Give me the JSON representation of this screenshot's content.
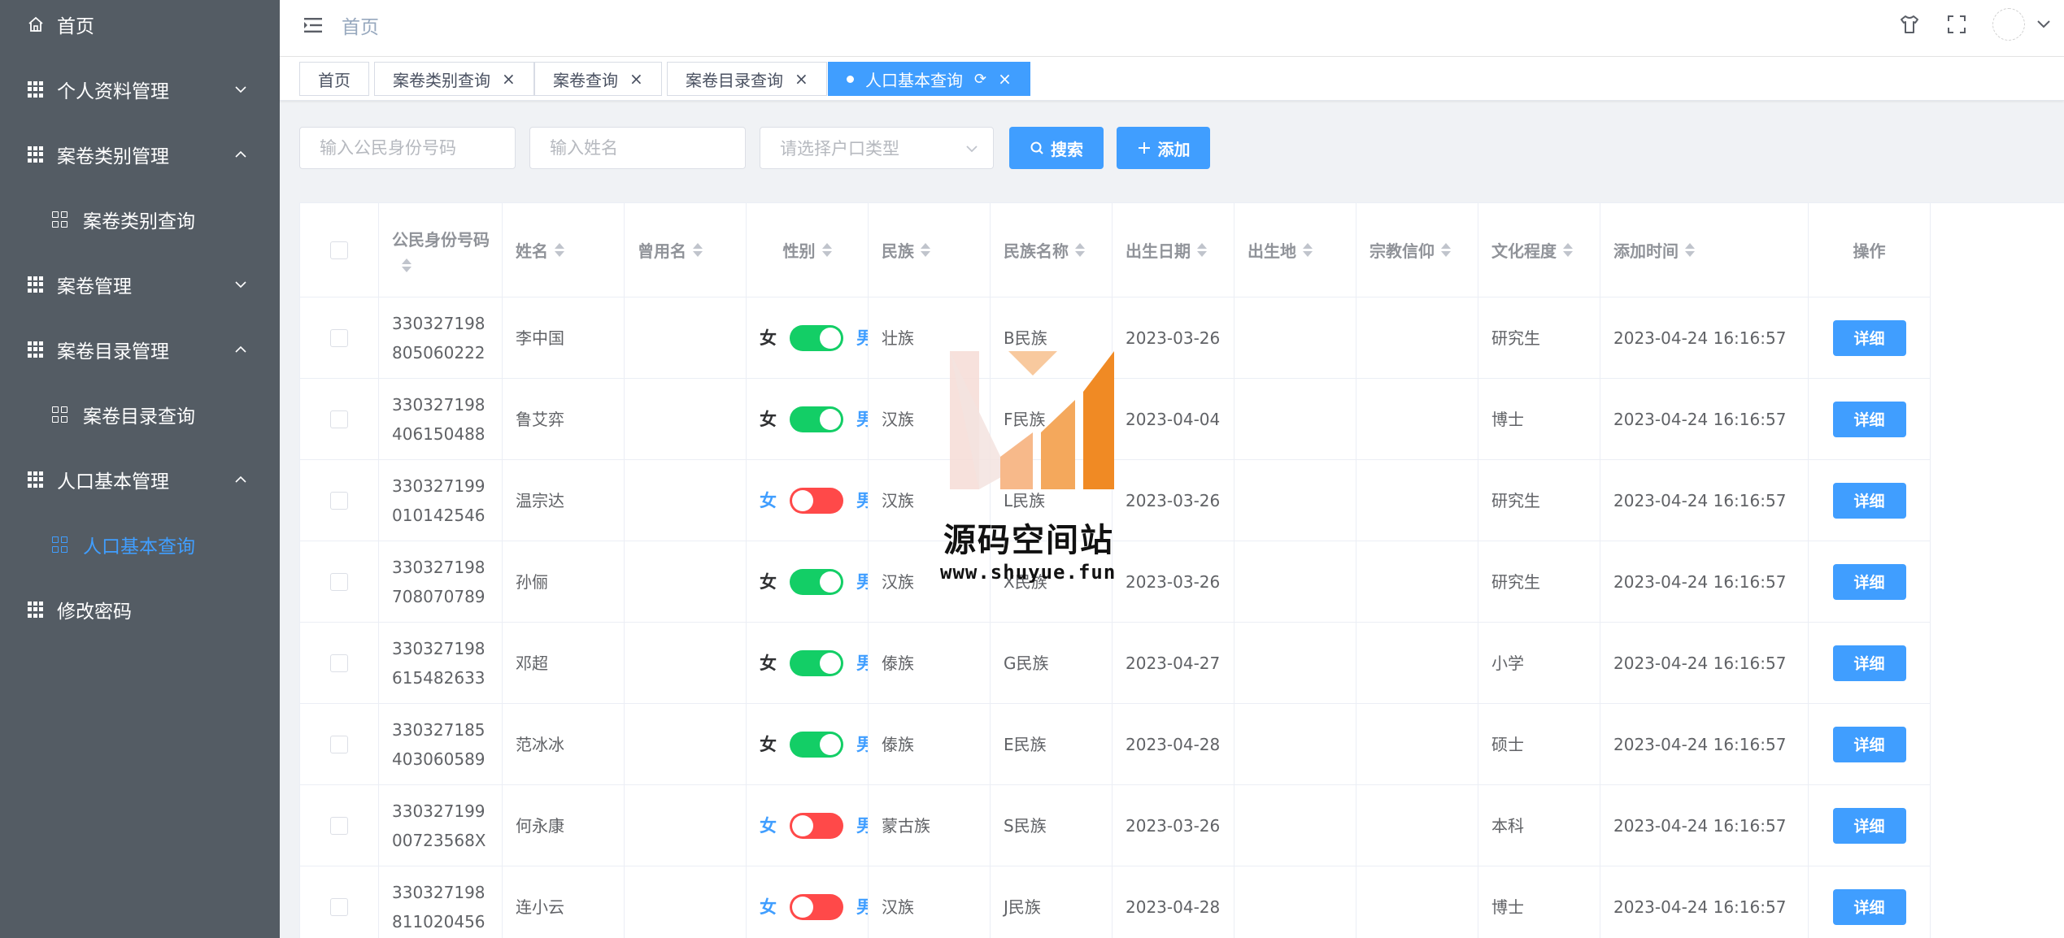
{
  "colors": {
    "primary": "#409eff",
    "sidebar_bg": "#545c64",
    "switch_on": "#13ce66",
    "switch_off": "#ff4949",
    "watermark_orange": "#f08a24"
  },
  "sidebar": {
    "items": [
      {
        "label": "首页",
        "icon": "home-icon"
      },
      {
        "label": "个人资料管理",
        "icon": "grid-icon",
        "chevron": "down"
      },
      {
        "label": "案卷类别管理",
        "icon": "grid-icon",
        "chevron": "up"
      },
      {
        "label": "案卷类别查询",
        "icon": "submenu-icon",
        "sub": true
      },
      {
        "label": "案卷管理",
        "icon": "grid-icon",
        "chevron": "down"
      },
      {
        "label": "案卷目录管理",
        "icon": "grid-icon",
        "chevron": "up"
      },
      {
        "label": "案卷目录查询",
        "icon": "submenu-icon",
        "sub": true
      },
      {
        "label": "人口基本管理",
        "icon": "grid-icon",
        "chevron": "up"
      },
      {
        "label": "人口基本查询",
        "icon": "submenu-icon",
        "sub": true,
        "active": true
      },
      {
        "label": "修改密码",
        "icon": "grid-icon"
      }
    ]
  },
  "header": {
    "breadcrumb": "首页"
  },
  "tabs": [
    {
      "label": "首页"
    },
    {
      "label": "案卷类别查询"
    },
    {
      "label": "案卷查询"
    },
    {
      "label": "案卷目录查询"
    },
    {
      "label": "人口基本查询",
      "active": true
    }
  ],
  "filters": {
    "id_placeholder": "输入公民身份号码",
    "name_placeholder": "输入姓名",
    "hukou_placeholder": "请选择户口类型",
    "search_label": "搜索",
    "add_label": "添加"
  },
  "table": {
    "columns": [
      "公民身份号码",
      "姓名",
      "曾用名",
      "性别",
      "民族",
      "民族名称",
      "出生日期",
      "出生地",
      "宗教信仰",
      "文化程度",
      "添加时间",
      "操作"
    ],
    "gender_female": "女",
    "gender_male": "男",
    "detail_label": "详细",
    "rows": [
      {
        "id": "330327198805060222",
        "name": "李中国",
        "former": "",
        "gender_on": true,
        "ethnic": "壮族",
        "ethnic_name": "B民族",
        "birth": "2023-03-26",
        "birthplace": "",
        "religion": "",
        "education": "研究生",
        "added": "2023-04-24 16:16:57"
      },
      {
        "id": "330327198406150488",
        "name": "鲁艾弈",
        "former": "",
        "gender_on": true,
        "ethnic": "汉族",
        "ethnic_name": "F民族",
        "birth": "2023-04-04",
        "birthplace": "",
        "religion": "",
        "education": "博士",
        "added": "2023-04-24 16:16:57"
      },
      {
        "id": "330327199010142546",
        "name": "温宗达",
        "former": "",
        "gender_on": false,
        "ethnic": "汉族",
        "ethnic_name": "L民族",
        "birth": "2023-03-26",
        "birthplace": "",
        "religion": "",
        "education": "研究生",
        "added": "2023-04-24 16:16:57"
      },
      {
        "id": "330327198708070789",
        "name": "孙俪",
        "former": "",
        "gender_on": true,
        "ethnic": "汉族",
        "ethnic_name": "X民族",
        "birth": "2023-03-26",
        "birthplace": "",
        "religion": "",
        "education": "研究生",
        "added": "2023-04-24 16:16:57"
      },
      {
        "id": "330327198615482633",
        "name": "邓超",
        "former": "",
        "gender_on": true,
        "ethnic": "傣族",
        "ethnic_name": "G民族",
        "birth": "2023-04-27",
        "birthplace": "",
        "religion": "",
        "education": "小学",
        "added": "2023-04-24 16:16:57"
      },
      {
        "id": "330327185403060589",
        "name": "范冰冰",
        "former": "",
        "gender_on": true,
        "ethnic": "傣族",
        "ethnic_name": "E民族",
        "birth": "2023-04-28",
        "birthplace": "",
        "religion": "",
        "education": "硕士",
        "added": "2023-04-24 16:16:57"
      },
      {
        "id": "33032719900723568X",
        "name": "何永康",
        "former": "",
        "gender_on": false,
        "ethnic": "蒙古族",
        "ethnic_name": "S民族",
        "birth": "2023-03-26",
        "birthplace": "",
        "religion": "",
        "education": "本科",
        "added": "2023-04-24 16:16:57"
      },
      {
        "id": "330327198811020456",
        "name": "连小云",
        "former": "",
        "gender_on": false,
        "ethnic": "汉族",
        "ethnic_name": "J民族",
        "birth": "2023-04-28",
        "birthplace": "",
        "religion": "",
        "education": "博士",
        "added": "2023-04-24 16:16:57"
      }
    ]
  },
  "watermark": {
    "title": "源码空间站",
    "url": "www.shuyue.fun"
  }
}
